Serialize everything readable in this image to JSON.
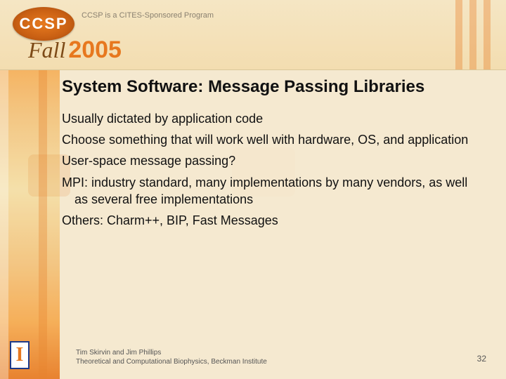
{
  "header": {
    "logo_text": "CCSP",
    "tagline": "CCSP is a CITES-Sponsored Program",
    "fall_word": "Fall",
    "fall_year": "2005"
  },
  "slide": {
    "title": "System Software:  Message Passing Libraries",
    "bullets": [
      "Usually dictated by application code",
      "Choose something that will work well with hardware, OS, and application",
      "User-space message passing?",
      "MPI: industry standard, many implementations by many vendors, as well as several free implementations",
      "Others: Charm++, BIP, Fast Messages"
    ]
  },
  "footer": {
    "line1": "Tim Skirvin and Jim Phillips",
    "line2": "Theoretical and Computational Biophysics, Beckman Institute"
  },
  "page_number": "32",
  "illini_letter": "I"
}
